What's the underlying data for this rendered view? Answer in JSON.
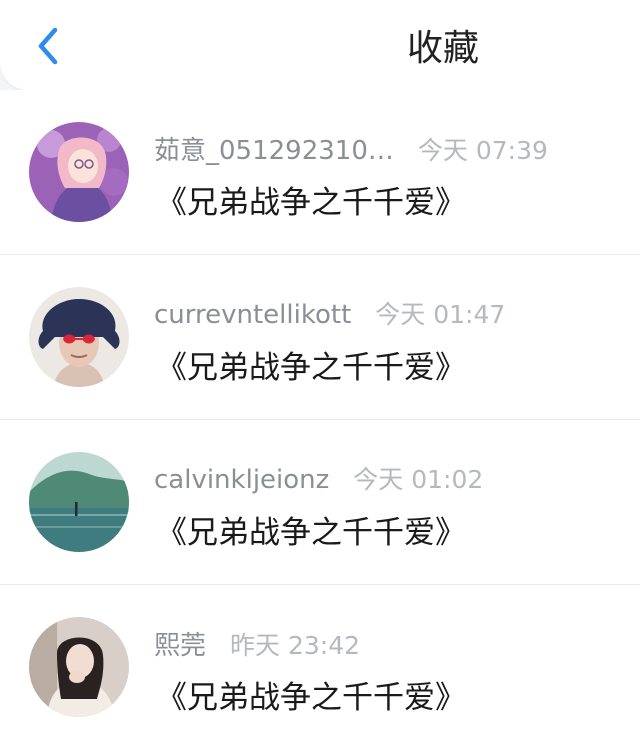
{
  "header": {
    "title": "收藏",
    "back_icon": "chevron-left-icon",
    "accent_color": "#2d8cf0"
  },
  "items": [
    {
      "username": "茹意_051292310…",
      "time": "今天 07:39",
      "content": "《兄弟战争之千千爱》"
    },
    {
      "username": "currevntellikott",
      "time": "今天 01:47",
      "content": "《兄弟战争之千千爱》"
    },
    {
      "username": "calvinkljeionz",
      "time": "今天 01:02",
      "content": "《兄弟战争之千千爱》"
    },
    {
      "username": "熙莞",
      "time": "昨天 23:42",
      "content": "《兄弟战争之千千爱》"
    }
  ]
}
